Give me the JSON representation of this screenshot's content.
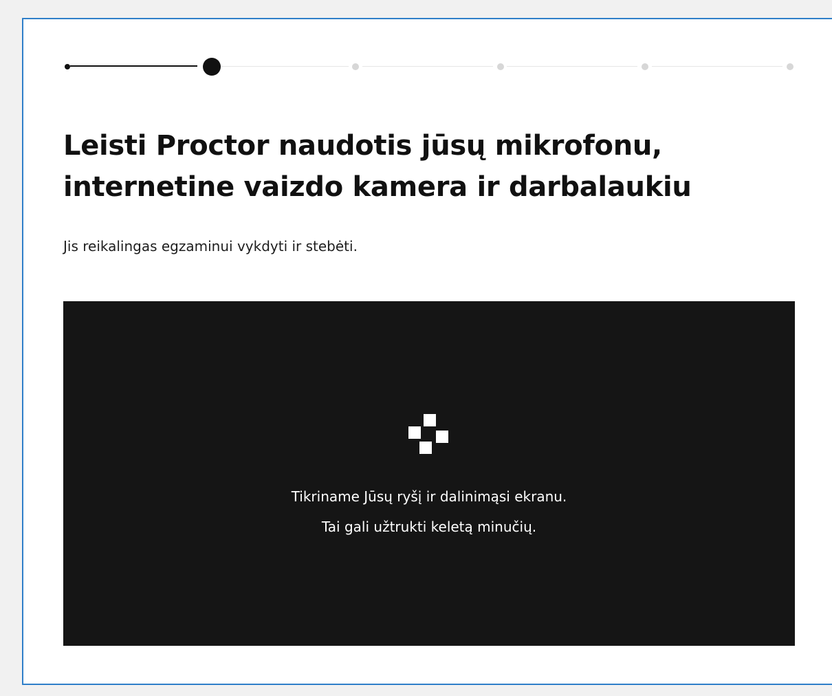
{
  "dialog": {
    "title_line1": "Leisti Proctor naudotis jūsų mikrofonu,",
    "title_line2": "internetine vaizdo kamera ir darbalaukiu",
    "subtitle": "Jis reikalingas egzaminui vykdyti ir stebėti."
  },
  "stepper": {
    "total_steps": 6,
    "current_step": 2
  },
  "video_panel": {
    "loading_icon": "loading-squares-icon",
    "status_line1": "Tikriname Jūsų ryšį ir dalinimąsi ekranu.",
    "status_line2": "Tai gali užtrukti keletą minučių."
  },
  "colors": {
    "accent_border": "#2f7fc9",
    "panel_background": "#151515",
    "active_step": "#111111",
    "inactive_step": "#d7d7d7"
  }
}
